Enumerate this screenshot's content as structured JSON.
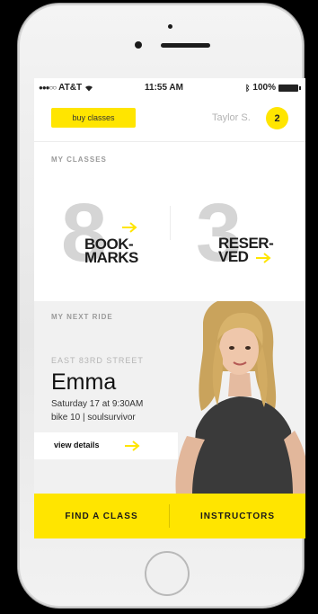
{
  "status_bar": {
    "carrier": "AT&T",
    "time": "11:55 AM",
    "battery": "100%"
  },
  "header": {
    "buy_label": "buy classes",
    "user_name": "Taylor S.",
    "notification_count": "2"
  },
  "my_classes": {
    "label": "MY CLASSES",
    "bookmarks": {
      "count": "8",
      "label_line1": "BOOK-",
      "label_line2": "MARKS"
    },
    "reserved": {
      "count": "3",
      "label_line1": "RESER-",
      "label_line2": "VED"
    }
  },
  "next_ride": {
    "label": "MY NEXT RIDE",
    "location": "EAST 83RD STREET",
    "instructor": "Emma",
    "time": "Saturday 17 at 9:30AM",
    "bike": "bike 10 | soulsurvivor",
    "view_label": "view details"
  },
  "bottom_nav": {
    "find_label": "FIND A CLASS",
    "instructors_label": "INSTRUCTORS"
  },
  "colors": {
    "accent": "#ffe500",
    "text_dark": "#111111",
    "muted": "#9a9a9a"
  },
  "icons": [
    "signal-dots-icon",
    "wifi-icon",
    "bluetooth-icon",
    "battery-icon",
    "arrow-right-icon",
    "instructor-photo"
  ]
}
